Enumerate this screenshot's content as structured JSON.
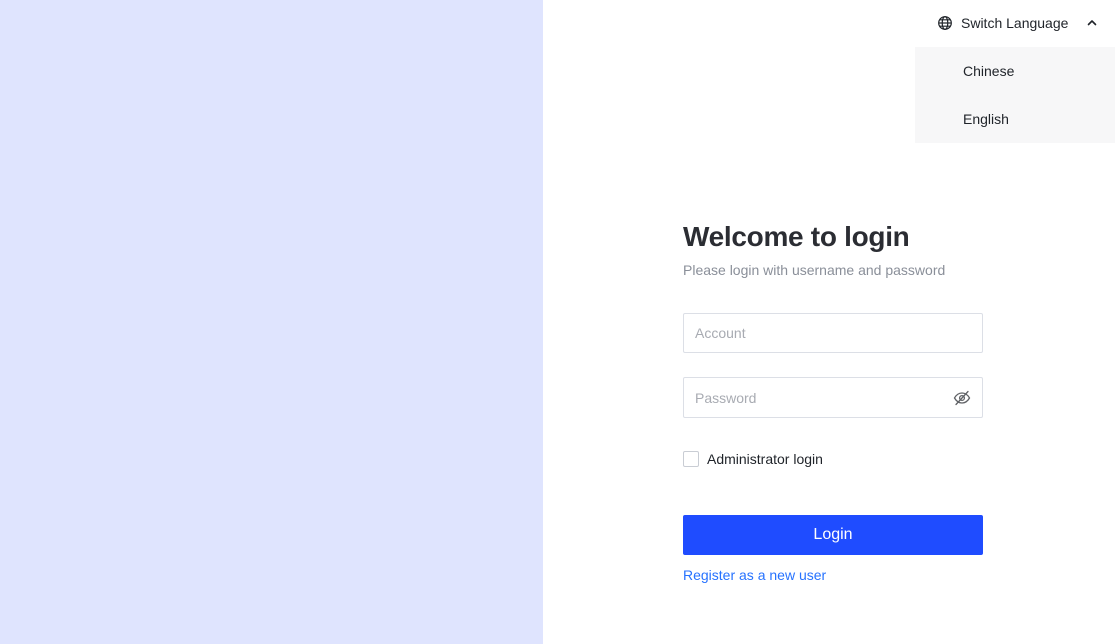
{
  "colors": {
    "left_panel_bg": "#dfe4fe",
    "primary": "#1f4cff",
    "link": "#2672ff"
  },
  "language_switcher": {
    "label": "Switch Language",
    "icon": "globe-icon",
    "chevron_icon": "chevron-up-icon",
    "options": [
      "Chinese",
      "English"
    ]
  },
  "login": {
    "title": "Welcome to login",
    "subtitle": "Please login with username and password",
    "account_placeholder": "Account",
    "password_placeholder": "Password",
    "password_toggle_icon": "eye-off-icon",
    "admin_checkbox_label": "Administrator login",
    "admin_checked": false,
    "login_button": "Login",
    "register_link": "Register as a new user"
  }
}
